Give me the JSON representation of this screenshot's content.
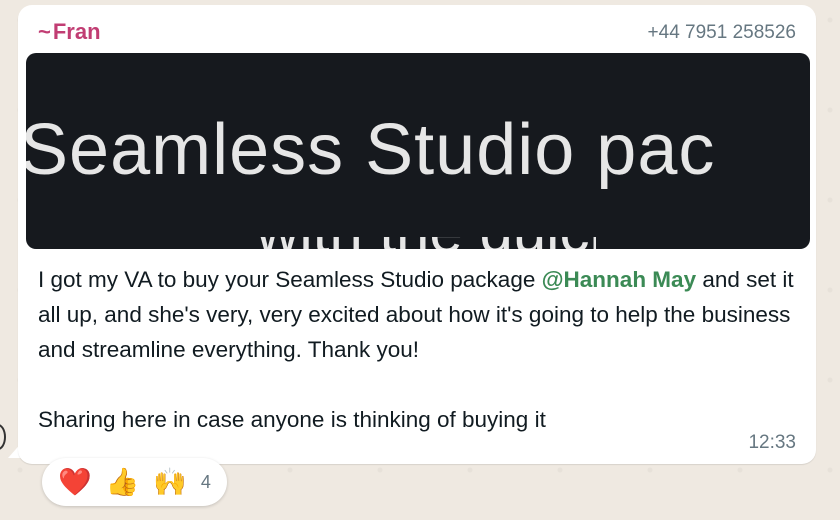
{
  "message": {
    "sender": {
      "tilde": "~",
      "name": "Fran",
      "phone": "+44 7951 258526"
    },
    "link_preview": {
      "image_text": "Seamless Studio pac",
      "image_text_second_line": "with the quick"
    },
    "body": {
      "part1": "I got my VA to buy your Seamless Studio package ",
      "mention": "@Hannah May",
      "part2": " and set it all up, and she's very, very excited about how it's going to help the business and streamline everything. Thank you!",
      "part3": "Sharing here in case anyone is thinking of buying it"
    },
    "time": "12:33"
  },
  "reactions": {
    "items": [
      "❤️",
      "👍",
      "🙌"
    ],
    "count": "4"
  },
  "colors": {
    "sender": "#c13d73",
    "mention": "#3b8a55",
    "meta_text": "#667781",
    "bubble": "#ffffff",
    "preview_bg": "#16191e"
  }
}
